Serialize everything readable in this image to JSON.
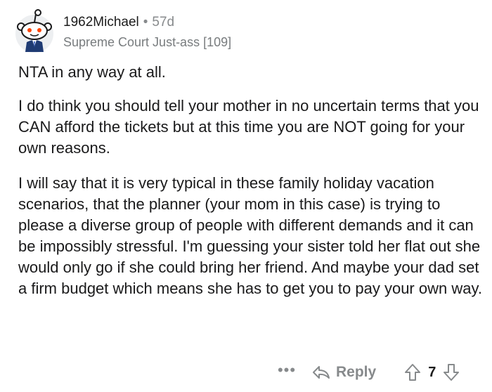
{
  "comment": {
    "username": "1962Michael",
    "separator": "•",
    "age": "57d",
    "flair": "Supreme Court Just-ass [109]",
    "paragraphs": [
      "NTA in any way at all.",
      "I do think you should tell your mother in no uncertain terms that you CAN afford the tickets but at this time you are NOT going for your own reasons.",
      "I will say that it is very typical in these family holiday vacation scenarios, that the planner (your mom in this case) is trying to please a diverse group of people with different demands and it can be impossibly stressful. I'm guessing your sister told her flat out she would only go if she could bring her friend. And maybe your dad set a firm budget which means she has to get you to pay your own way."
    ],
    "actions": {
      "more_label": "•••",
      "reply_label": "Reply",
      "score": "7"
    },
    "avatar_icon": "snoo-avatar-icon",
    "colors": {
      "text": "#1a1a1b",
      "muted": "#878a8c",
      "avatar_bg": "#edeff1"
    }
  }
}
